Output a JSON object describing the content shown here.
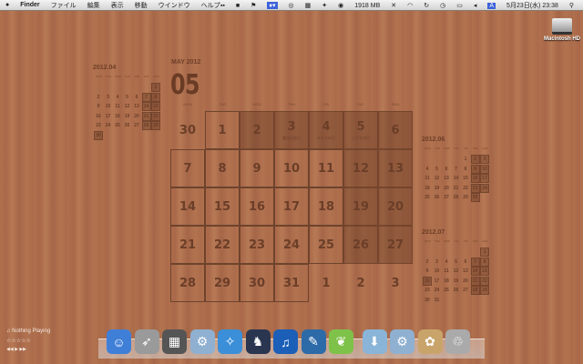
{
  "menubar": {
    "apple": "",
    "app": "Finder",
    "items": [
      "ファイル",
      "編集",
      "表示",
      "移動",
      "ウインドウ",
      "ヘルプ"
    ],
    "memory": "1918 MB",
    "datetime": "5月23日(水) 23:38",
    "input": "A"
  },
  "weekdays": [
    "MON",
    "TUE",
    "WED",
    "THU",
    "FRI",
    "SAT",
    "SUN"
  ],
  "main_calendar": {
    "title": "MAY 2012",
    "month": "05",
    "weeks": [
      [
        "30",
        "1",
        "2",
        "3",
        "4",
        "5",
        "6"
      ],
      [
        "7",
        "8",
        "9",
        "10",
        "11",
        "12",
        "13"
      ],
      [
        "14",
        "15",
        "16",
        "17",
        "18",
        "19",
        "20"
      ],
      [
        "21",
        "22",
        "23",
        "24",
        "25",
        "26",
        "27"
      ],
      [
        "28",
        "29",
        "30",
        "31",
        "1",
        "2",
        "3"
      ]
    ],
    "holidays": {
      "3": "憲法記念日",
      "4": "みどりの日",
      "5": "こどもの日"
    }
  },
  "small_calendars": [
    {
      "title": "2012.04",
      "weeks": [
        [
          "",
          "",
          "",
          "",
          "",
          "",
          "1"
        ],
        [
          "2",
          "3",
          "4",
          "5",
          "6",
          "7",
          "8"
        ],
        [
          "9",
          "10",
          "11",
          "12",
          "13",
          "14",
          "15"
        ],
        [
          "16",
          "17",
          "18",
          "19",
          "20",
          "21",
          "22"
        ],
        [
          "23",
          "24",
          "25",
          "26",
          "27",
          "28",
          "29"
        ],
        [
          "30",
          "",
          "",
          "",
          "",
          "",
          ""
        ]
      ],
      "shaded": [
        "1",
        "7",
        "8",
        "14",
        "15",
        "21",
        "22",
        "28",
        "29",
        "30"
      ]
    },
    {
      "title": "2012.06",
      "weeks": [
        [
          "",
          "",
          "",
          "",
          "1",
          "2",
          "3"
        ],
        [
          "4",
          "5",
          "6",
          "7",
          "8",
          "9",
          "10"
        ],
        [
          "11",
          "12",
          "13",
          "14",
          "15",
          "16",
          "17"
        ],
        [
          "18",
          "19",
          "20",
          "21",
          "22",
          "23",
          "24"
        ],
        [
          "25",
          "26",
          "27",
          "28",
          "29",
          "30",
          ""
        ]
      ],
      "shaded": [
        "2",
        "3",
        "9",
        "10",
        "16",
        "17",
        "23",
        "24",
        "30"
      ]
    },
    {
      "title": "2012.07",
      "weeks": [
        [
          "",
          "",
          "",
          "",
          "",
          "",
          "1"
        ],
        [
          "2",
          "3",
          "4",
          "5",
          "6",
          "7",
          "8"
        ],
        [
          "9",
          "10",
          "11",
          "12",
          "13",
          "14",
          "15"
        ],
        [
          "16",
          "17",
          "18",
          "19",
          "20",
          "21",
          "22"
        ],
        [
          "23",
          "24",
          "25",
          "26",
          "27",
          "28",
          "29"
        ],
        [
          "30",
          "31",
          "",
          "",
          "",
          "",
          ""
        ]
      ],
      "shaded": [
        "1",
        "7",
        "8",
        "14",
        "15",
        "16",
        "21",
        "22",
        "28",
        "29"
      ]
    }
  ],
  "now_playing": {
    "label": "♫ Nothing Playing",
    "rating": "☆☆☆☆☆",
    "controls": "◀◀ ▶ ▶▶"
  },
  "desktop": {
    "drive": "Macintosh HD"
  },
  "dock": [
    "Finder",
    "Launchpad",
    "Mission Control",
    "Disk Utility",
    "Safari",
    "Chess",
    "iTunes",
    "Twitter",
    "Evernote",
    "Downloads",
    "Disk Utility",
    "Archive",
    "Trash"
  ]
}
